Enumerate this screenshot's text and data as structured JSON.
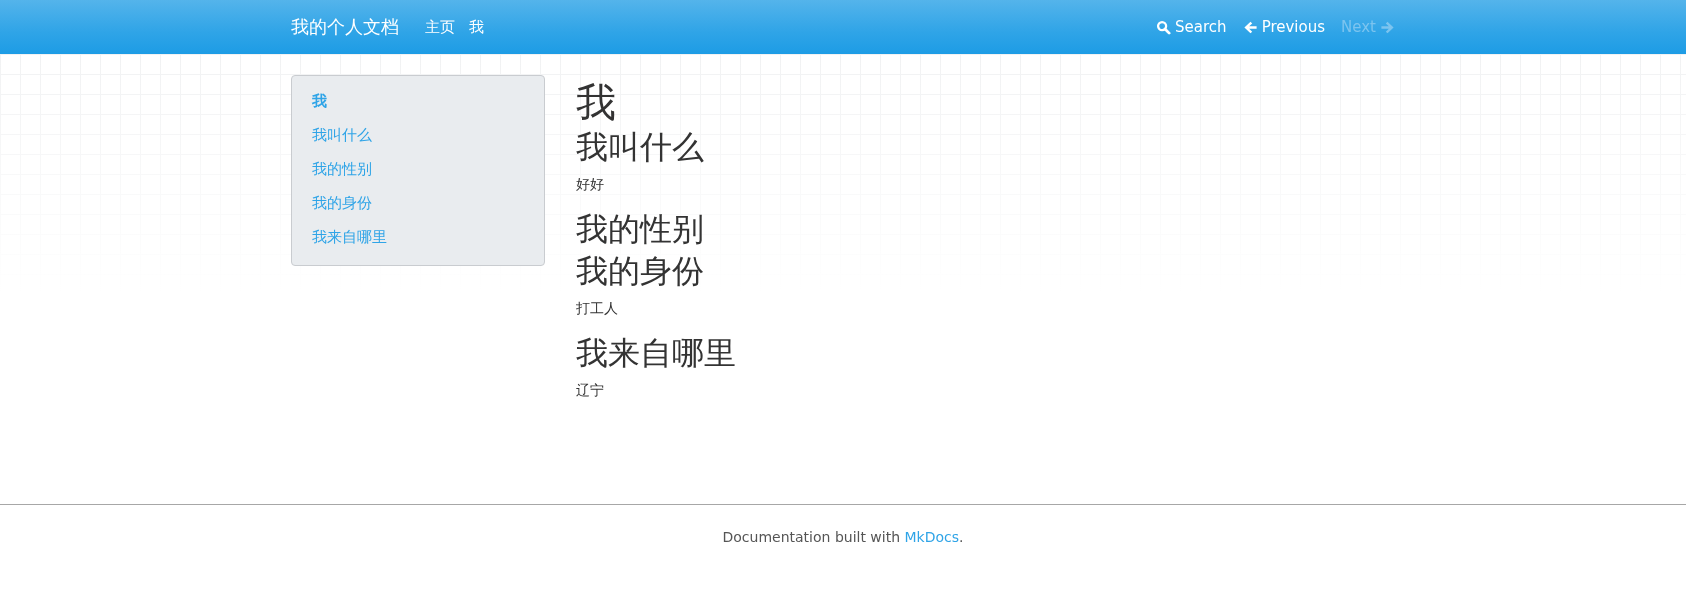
{
  "navbar": {
    "brand": "我的个人文档",
    "links": [
      {
        "label": "主页"
      },
      {
        "label": "我"
      }
    ],
    "actions": [
      {
        "kind": "search",
        "label": "Search",
        "disabled": false
      },
      {
        "kind": "previous",
        "label": "Previous",
        "disabled": false
      },
      {
        "kind": "next",
        "label": "Next",
        "disabled": true
      }
    ]
  },
  "sidebar": {
    "items": [
      {
        "label": "我",
        "selected": true
      },
      {
        "label": "我叫什么",
        "selected": false
      },
      {
        "label": "我的性别",
        "selected": false
      },
      {
        "label": "我的身份",
        "selected": false
      },
      {
        "label": "我来自哪里",
        "selected": false
      }
    ]
  },
  "content": [
    {
      "kind": "h1",
      "text": "我"
    },
    {
      "kind": "h2",
      "text": "我叫什么"
    },
    {
      "kind": "p",
      "text": "好好"
    },
    {
      "kind": "h2",
      "text": "我的性别"
    },
    {
      "kind": "h2",
      "text": "我的身份"
    },
    {
      "kind": "p",
      "text": "打工人"
    },
    {
      "kind": "h2",
      "text": "我来自哪里"
    },
    {
      "kind": "p",
      "text": "辽宁"
    }
  ],
  "footer": {
    "text_before": "Documentation built with ",
    "link": "MkDocs",
    "text_after": "."
  }
}
